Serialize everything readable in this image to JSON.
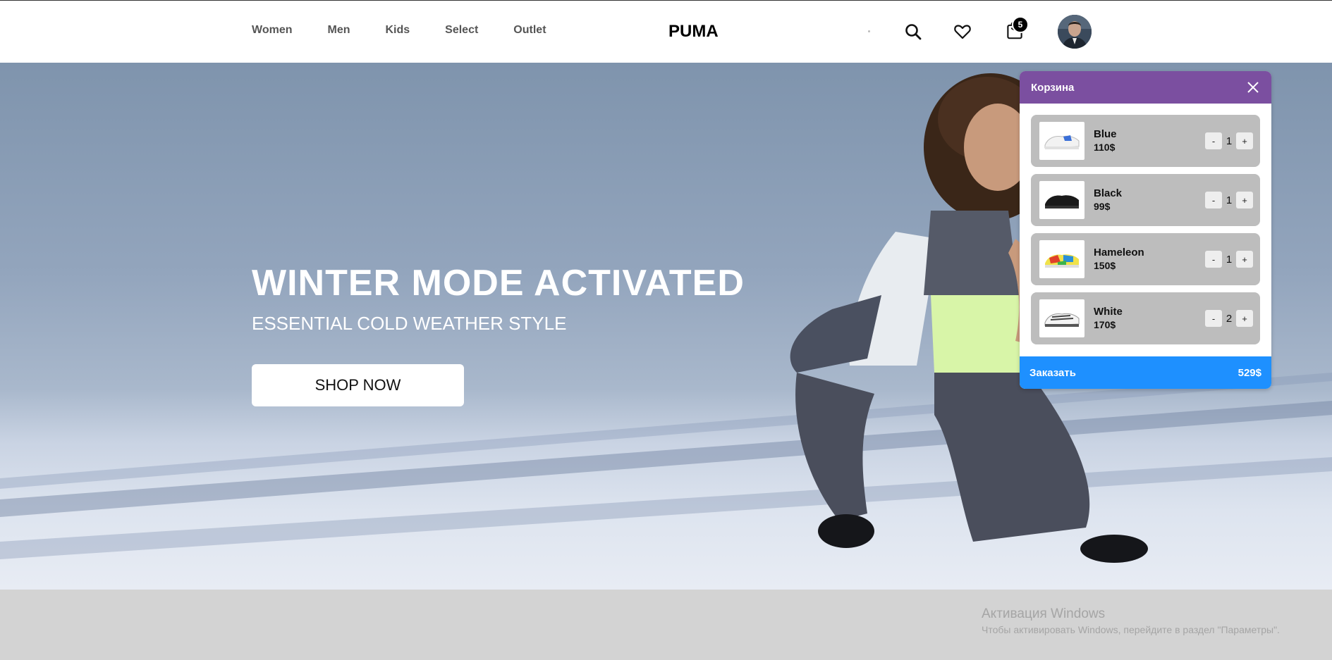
{
  "header": {
    "nav": [
      "Women",
      "Men",
      "Kids",
      "Select",
      "Outlet"
    ],
    "logo": "PUMA",
    "cart_count": "5",
    "icons": [
      "search-icon",
      "heart-icon",
      "shopping-bag-icon"
    ]
  },
  "hero": {
    "title": "WINTER MODE ACTIVATED",
    "subtitle": "ESSENTIAL COLD WEATHER STYLE",
    "button": "SHOP NOW"
  },
  "cart": {
    "title": "Корзина",
    "items": [
      {
        "name": "Blue",
        "price": "110$",
        "qty": "1"
      },
      {
        "name": "Black",
        "price": "99$",
        "qty": "1"
      },
      {
        "name": "Hameleon",
        "price": "150$",
        "qty": "1"
      },
      {
        "name": "White",
        "price": "170$",
        "qty": "2"
      }
    ],
    "minus": "-",
    "plus": "+",
    "order_label": "Заказать",
    "total": "529$"
  },
  "watermark": {
    "title": "Активация Windows",
    "text": "Чтобы активировать Windows, перейдите в раздел \"Параметры\"."
  },
  "colors": {
    "cart_header": "#7b4fa0",
    "cart_footer": "#1e90ff",
    "item_bg": "#bdbdbd"
  }
}
